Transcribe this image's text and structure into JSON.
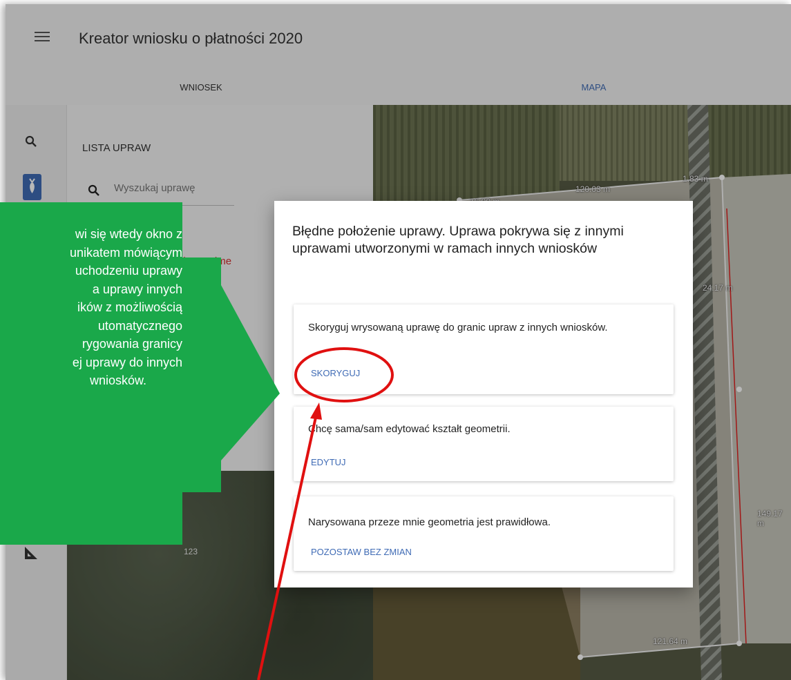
{
  "header": {
    "title": "Kreator wniosku o płatności 2020"
  },
  "tabs": [
    {
      "label": "WNIOSEK"
    },
    {
      "label": "MAPA"
    }
  ],
  "panel": {
    "title": "LISTA UPRAW",
    "search_placeholder": "Wyszukaj uprawę",
    "crop_partial": "nżyto ozime",
    "forest_label": "123"
  },
  "map": {
    "labels": [
      "16.90 m",
      "120.03 m",
      "1.83 m",
      "24.17 m",
      "149.17 m",
      "121.64 m"
    ]
  },
  "dialog": {
    "title": "Błędne położenie uprawy. Uprawa pokrywa się z innymi uprawami utworzonymi w ramach innych wniosków",
    "options": [
      {
        "text": "Skoryguj wrysowaną uprawę do granic upraw z innych wniosków.",
        "action": "SKORYGUJ"
      },
      {
        "text": "Chcę sama/sam edytować kształt geometrii.",
        "action": "EDYTUJ"
      },
      {
        "text": "Narysowana przeze mnie geometria jest prawidłowa.",
        "action": "POZOSTAW BEZ ZMIAN"
      }
    ]
  },
  "callout": {
    "lines": [
      "wi się wtedy okno z",
      "unikatem mówiącym",
      "uchodzeniu uprawy",
      "a uprawy innych",
      "ików z możliwością",
      "utomatycznego",
      "rygowania granicy",
      "ej uprawy do innych",
      "wniosków."
    ]
  },
  "colors": {
    "accent": "#3f6bb5",
    "callout_green": "#1aa84a",
    "annotation_red": "#e01010",
    "error_red": "#d32f2f"
  }
}
